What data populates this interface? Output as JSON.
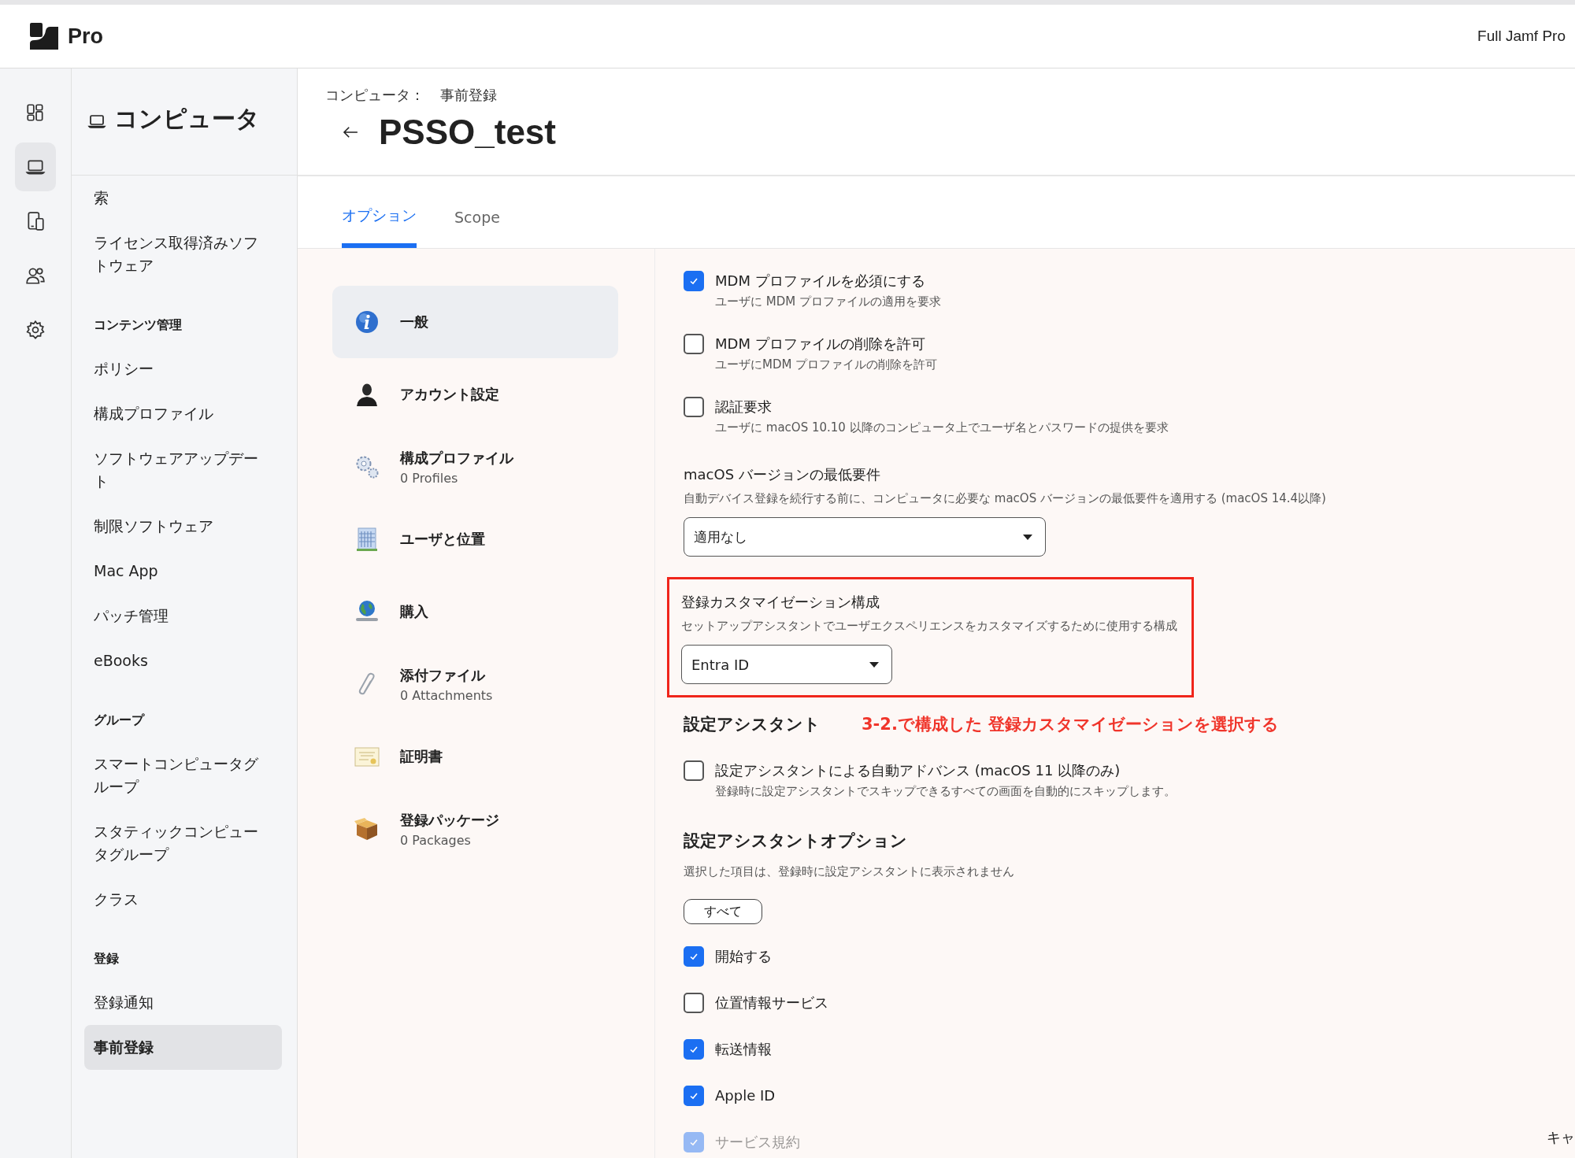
{
  "header": {
    "logo_text": "Pro",
    "account": "Full Jamf Pro"
  },
  "rail": [
    {
      "selected": false
    },
    {
      "selected": true
    },
    {
      "selected": false
    },
    {
      "selected": false
    },
    {
      "selected": false
    }
  ],
  "sidebar": {
    "title": "コンピュータ",
    "items": [
      {
        "kind": "link",
        "label": "索",
        "selected": false
      },
      {
        "kind": "link",
        "label": "ライセンス取得済みソフトウェア",
        "selected": false
      },
      {
        "kind": "heading",
        "label": "コンテンツ管理"
      },
      {
        "kind": "link",
        "label": "ポリシー",
        "selected": false
      },
      {
        "kind": "link",
        "label": "構成プロファイル",
        "selected": false
      },
      {
        "kind": "link",
        "label": "ソフトウェアアップデート",
        "selected": false
      },
      {
        "kind": "link",
        "label": "制限ソフトウェア",
        "selected": false
      },
      {
        "kind": "link",
        "label": "Mac App",
        "selected": false
      },
      {
        "kind": "link",
        "label": "パッチ管理",
        "selected": false
      },
      {
        "kind": "link",
        "label": "eBooks",
        "selected": false
      },
      {
        "kind": "heading",
        "label": "グループ"
      },
      {
        "kind": "link",
        "label": "スマートコンピュータグループ",
        "selected": false
      },
      {
        "kind": "link",
        "label": "スタティックコンピュータグループ",
        "selected": false
      },
      {
        "kind": "link",
        "label": "クラス",
        "selected": false
      },
      {
        "kind": "heading",
        "label": "登録"
      },
      {
        "kind": "link",
        "label": "登録通知",
        "selected": false
      },
      {
        "kind": "link",
        "label": "事前登録",
        "selected": true
      }
    ]
  },
  "breadcrumb": {
    "section": "コンピュータ：",
    "page": "事前登録"
  },
  "title": "PSSO_test",
  "tabs": [
    {
      "label": "オプション",
      "selected": true
    },
    {
      "label": "Scope",
      "selected": false
    }
  ],
  "nav": [
    {
      "label": "一般",
      "selected": true
    },
    {
      "label": "アカウント設定",
      "selected": false
    },
    {
      "label": "構成プロファイル",
      "count": "0 Profiles",
      "selected": false
    },
    {
      "label": "ユーザと位置",
      "selected": false
    },
    {
      "label": "購入",
      "selected": false
    },
    {
      "label": "添付ファイル",
      "count": "0 Attachments",
      "selected": false
    },
    {
      "label": "証明書",
      "selected": false
    },
    {
      "label": "登録パッケージ",
      "count": "0 Packages",
      "selected": false
    }
  ],
  "options": [
    {
      "kind": "checkbox",
      "label": "MDM プロファイルを必須にする",
      "description": "ユーザに MDM プロファイルの適用を要求",
      "checked": true,
      "faded": false
    },
    {
      "kind": "checkbox",
      "label": "MDM プロファイルの削除を許可",
      "description": "ユーザにMDM プロファイルの削除を許可",
      "checked": false,
      "faded": false
    },
    {
      "kind": "checkbox",
      "label": "認証要求",
      "description": "ユーザに macOS 10.10 以降のコンピュータ上でユーザ名とパスワードの提供を要求",
      "checked": false,
      "faded": false
    },
    {
      "kind": "select",
      "label": "macOS バージョンの最低要件",
      "description": "自動デバイス登録を続行する前に、コンピュータに必要な macOS バージョンの最低要件を適用する (macOS 14.4以降)",
      "value": "適用なし"
    },
    {
      "kind": "select",
      "label": "登録カスタマイゼーション構成",
      "description": "セットアップアシスタントでユーザエクスペリエンスをカスタマイズするために使用する構成",
      "value": "Entra ID",
      "highlighted": true
    },
    {
      "kind": "heading",
      "label": "設定アシスタント",
      "note": "3-2.で構成した 登録カスタマイゼーションを選択する"
    },
    {
      "kind": "checkbox",
      "label": "設定アシスタントによる自動アドバンス (macOS 11 以降のみ)",
      "description": "登録時に設定アシスタントでスキップできるすべての画面を自動的にスキップします。",
      "checked": false,
      "faded": false
    },
    {
      "kind": "heading",
      "label": "設定アシスタントオプション",
      "description": "選択した項目は、登録時に設定アシスタントに表示されません"
    },
    {
      "kind": "button",
      "label": "すべて"
    },
    {
      "kind": "checkbox",
      "label": "開始する",
      "checked": true,
      "faded": false
    },
    {
      "kind": "checkbox",
      "label": "位置情報サービス",
      "checked": false,
      "faded": false
    },
    {
      "kind": "checkbox",
      "label": "転送情報",
      "checked": true,
      "faded": false
    },
    {
      "kind": "checkbox",
      "label": "Apple ID",
      "checked": true,
      "faded": false
    },
    {
      "kind": "checkbox",
      "label": "サービス規約",
      "checked": true,
      "faded": true
    }
  ],
  "footer_button": "キャ"
}
